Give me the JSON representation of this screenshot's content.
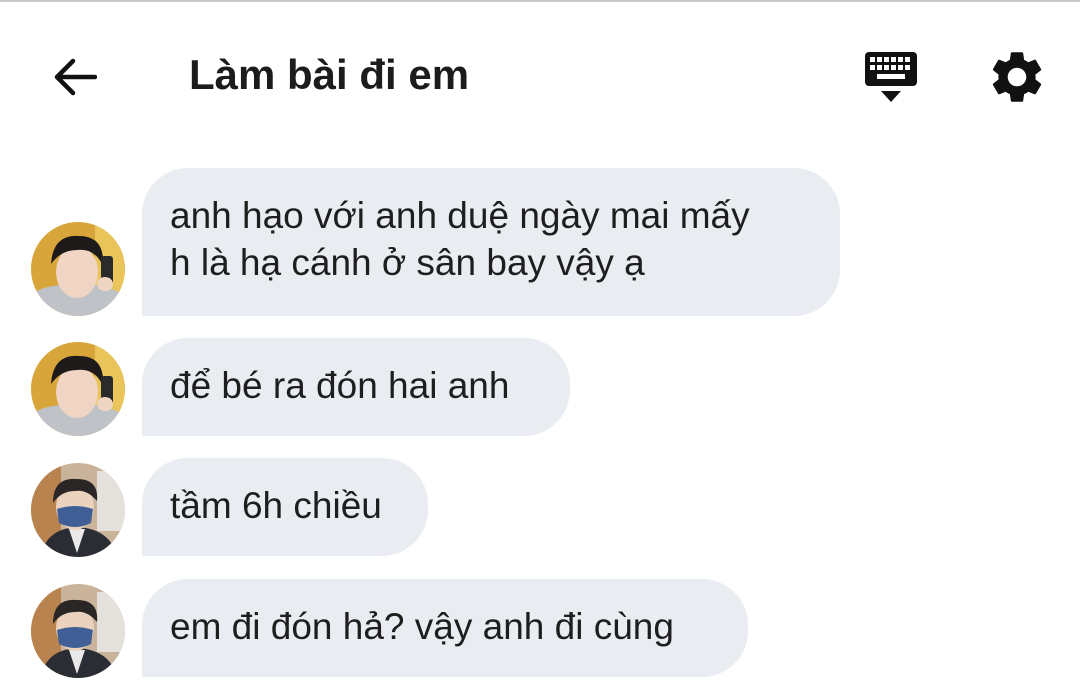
{
  "header": {
    "title": "Làm bài đi em",
    "back_icon": "arrow-left-icon",
    "keyboard_icon": "keyboard-icon",
    "settings_icon": "gear-icon"
  },
  "colors": {
    "bubble": "#e9ecf1",
    "text": "#1e1e1e",
    "title": "#1c1c1c",
    "background": "#ffffff"
  },
  "messages": [
    {
      "sender": "avatar-1",
      "lines": [
        "anh hạo với anh duệ ngày mai mấy",
        "h là hạ cánh ở sân bay vậy ạ"
      ]
    },
    {
      "sender": "avatar-1",
      "lines": [
        "để bé ra đón hai anh"
      ]
    },
    {
      "sender": "avatar-2",
      "lines": [
        "tầm 6h chiều"
      ]
    },
    {
      "sender": "avatar-2",
      "lines": [
        "em đi đón hả? vậy anh đi cùng"
      ]
    }
  ]
}
